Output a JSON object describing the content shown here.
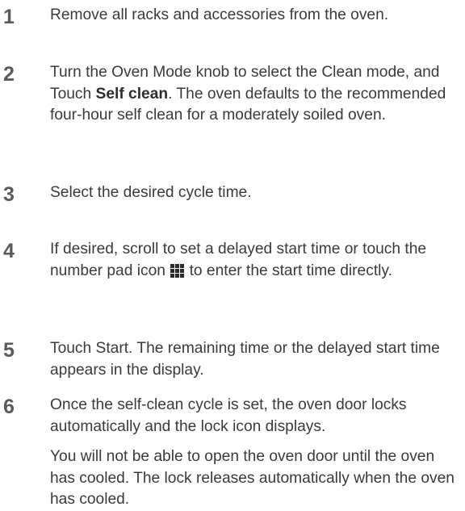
{
  "steps": [
    {
      "number": "1",
      "text": "Remove all racks and accessories from the oven."
    },
    {
      "number": "2",
      "text_before": "Turn the Oven Mode knob to select the Clean mode, and Touch ",
      "bold": "Self clean",
      "text_after": ". The oven defaults to the recommended four-hour self clean for a moderately soiled oven."
    },
    {
      "number": "3",
      "text": "Select the desired cycle time."
    },
    {
      "number": "4",
      "text_before": "If desired, scroll to set a delayed start time or touch the number pad icon ",
      "icon": "number-pad-icon",
      "text_after": " to enter the start time directly."
    },
    {
      "number": "5",
      "text": "Touch Start. The remaining time or the delayed start time appears in the display."
    },
    {
      "number": "6",
      "text": "Once the self-clean cycle is set, the oven door locks automatically and the lock icon displays.",
      "note": "You will not be able to open the oven door until the oven has cooled. The lock releases automatically when the oven has cooled."
    }
  ]
}
